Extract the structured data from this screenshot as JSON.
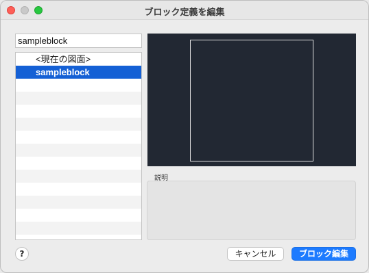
{
  "window": {
    "title": "ブロック定義を編集"
  },
  "name_field": {
    "value": "sampleblock"
  },
  "block_list": {
    "items": [
      {
        "label": "<現在の図面>",
        "selected": false
      },
      {
        "label": "sampleblock",
        "selected": true
      }
    ],
    "empty_rows": 12
  },
  "description": {
    "label": "説明",
    "value": ""
  },
  "buttons": {
    "help": "?",
    "cancel": "キャンセル",
    "edit_block": "ブロック編集"
  },
  "colors": {
    "selection": "#1460d5",
    "primary_button": "#1d7bff",
    "preview_background": "#222833"
  }
}
